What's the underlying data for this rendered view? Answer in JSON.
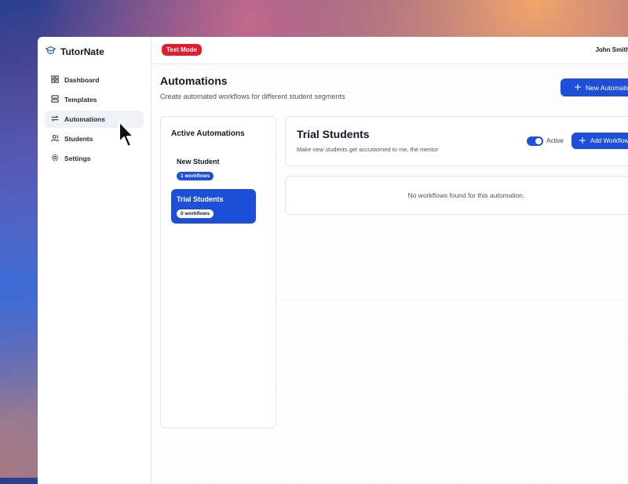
{
  "app": {
    "name": "TutorNate"
  },
  "topbar": {
    "badge": "Test Mode",
    "user_name": "John Smith"
  },
  "sidebar": {
    "items": [
      {
        "label": "Dashboard",
        "icon": "grid-icon"
      },
      {
        "label": "Templates",
        "icon": "template-icon"
      },
      {
        "label": "Automations",
        "icon": "swap-icon",
        "active": true
      },
      {
        "label": "Students",
        "icon": "users-icon"
      },
      {
        "label": "Settings",
        "icon": "gear-icon"
      }
    ]
  },
  "page": {
    "title": "Automations",
    "subtitle": "Create automated workflows for different student segments",
    "new_button": "New Automation"
  },
  "active_panel": {
    "title": "Active Automations",
    "items": [
      {
        "name": "New Student",
        "count": "1 workflows"
      },
      {
        "name": "Trial Students",
        "count": "0 workflows",
        "selected": true
      }
    ]
  },
  "detail": {
    "title": "Trial Students",
    "subtitle": "Make new students get accustomed to me, the mentor",
    "toggle_label": "Active",
    "add_button": "Add Workflow",
    "empty_message": "No workflows found for this automation."
  },
  "colors": {
    "accent": "#1d4fd8",
    "badge": "#e11d2e"
  }
}
